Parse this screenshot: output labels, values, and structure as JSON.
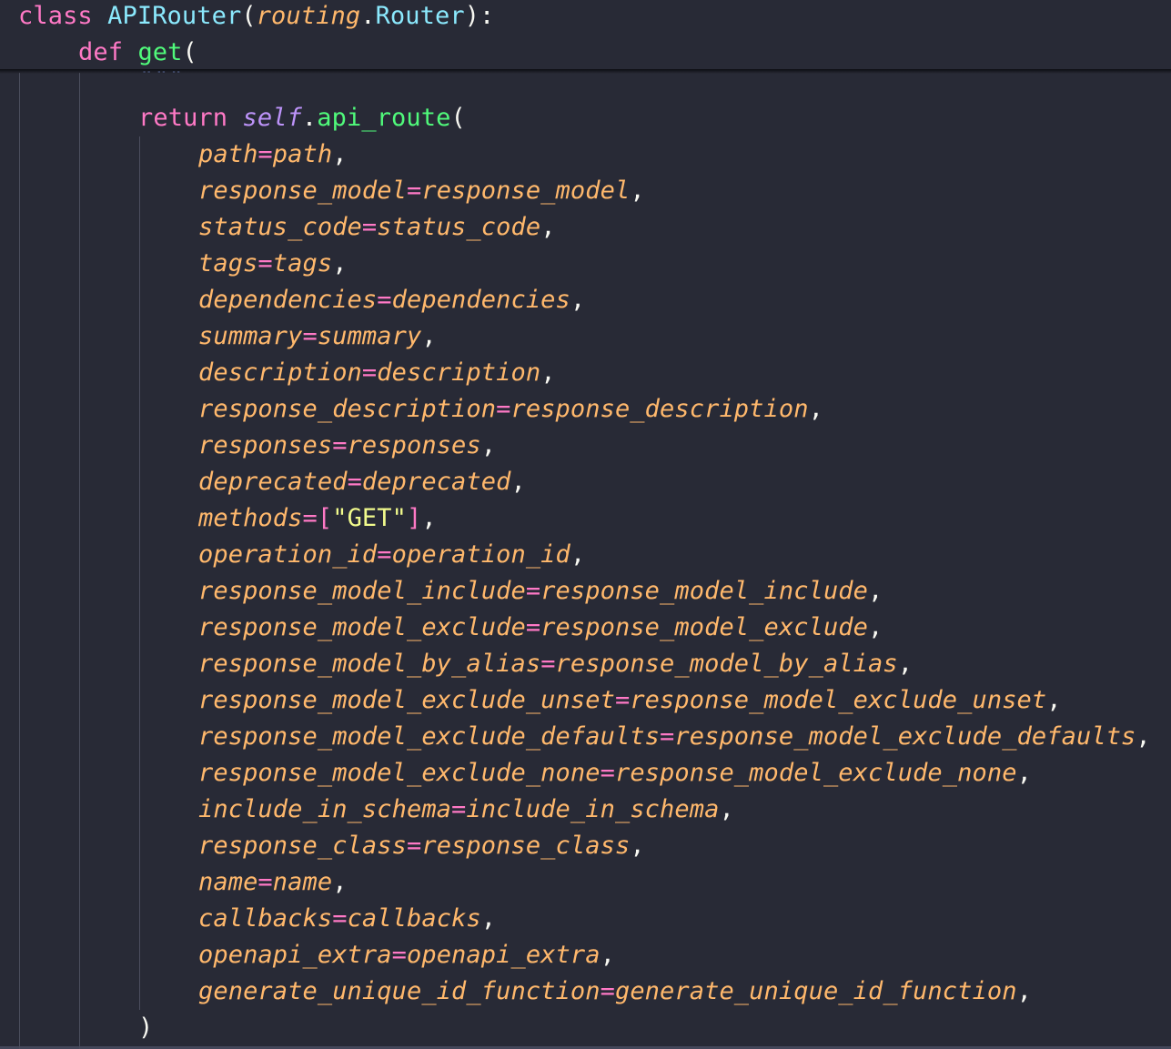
{
  "sticky": {
    "class_kw": "class",
    "class_name": "APIRouter",
    "open_paren": "(",
    "base_module": "routing",
    "dot": ".",
    "base_class": "Router",
    "close": "):",
    "def_kw": "def",
    "func_name": "get",
    "func_paren": "("
  },
  "docstring_tail": "\"\"\"",
  "return_line": {
    "kw": "return",
    "self": "self",
    "dot": ".",
    "method": "api_route",
    "paren": "("
  },
  "arguments": [
    {
      "name": "path",
      "value": "path"
    },
    {
      "name": "response_model",
      "value": "response_model"
    },
    {
      "name": "status_code",
      "value": "status_code"
    },
    {
      "name": "tags",
      "value": "tags"
    },
    {
      "name": "dependencies",
      "value": "dependencies"
    },
    {
      "name": "summary",
      "value": "summary"
    },
    {
      "name": "description",
      "value": "description"
    },
    {
      "name": "response_description",
      "value": "response_description"
    },
    {
      "name": "responses",
      "value": "responses"
    },
    {
      "name": "deprecated",
      "value": "deprecated"
    },
    {
      "name": "methods",
      "value": "[\"GET\"]"
    },
    {
      "name": "operation_id",
      "value": "operation_id"
    },
    {
      "name": "response_model_include",
      "value": "response_model_include"
    },
    {
      "name": "response_model_exclude",
      "value": "response_model_exclude"
    },
    {
      "name": "response_model_by_alias",
      "value": "response_model_by_alias"
    },
    {
      "name": "response_model_exclude_unset",
      "value": "response_model_exclude_unset"
    },
    {
      "name": "response_model_exclude_defaults",
      "value": "response_model_exclude_defaults"
    },
    {
      "name": "response_model_exclude_none",
      "value": "response_model_exclude_none"
    },
    {
      "name": "include_in_schema",
      "value": "include_in_schema"
    },
    {
      "name": "response_class",
      "value": "response_class"
    },
    {
      "name": "name",
      "value": "name"
    },
    {
      "name": "callbacks",
      "value": "callbacks"
    },
    {
      "name": "openapi_extra",
      "value": "openapi_extra"
    },
    {
      "name": "generate_unique_id_function",
      "value": "generate_unique_id_function"
    }
  ],
  "closing_paren": ")",
  "theme": {
    "background": "#282a36",
    "keyword": "#ff79c6",
    "class_name": "#8be9fd",
    "function": "#50fa7b",
    "parameter": "#ffb86c",
    "self": "#bd93f9",
    "string": "#f1fa8c",
    "foreground": "#f8f8f2"
  }
}
